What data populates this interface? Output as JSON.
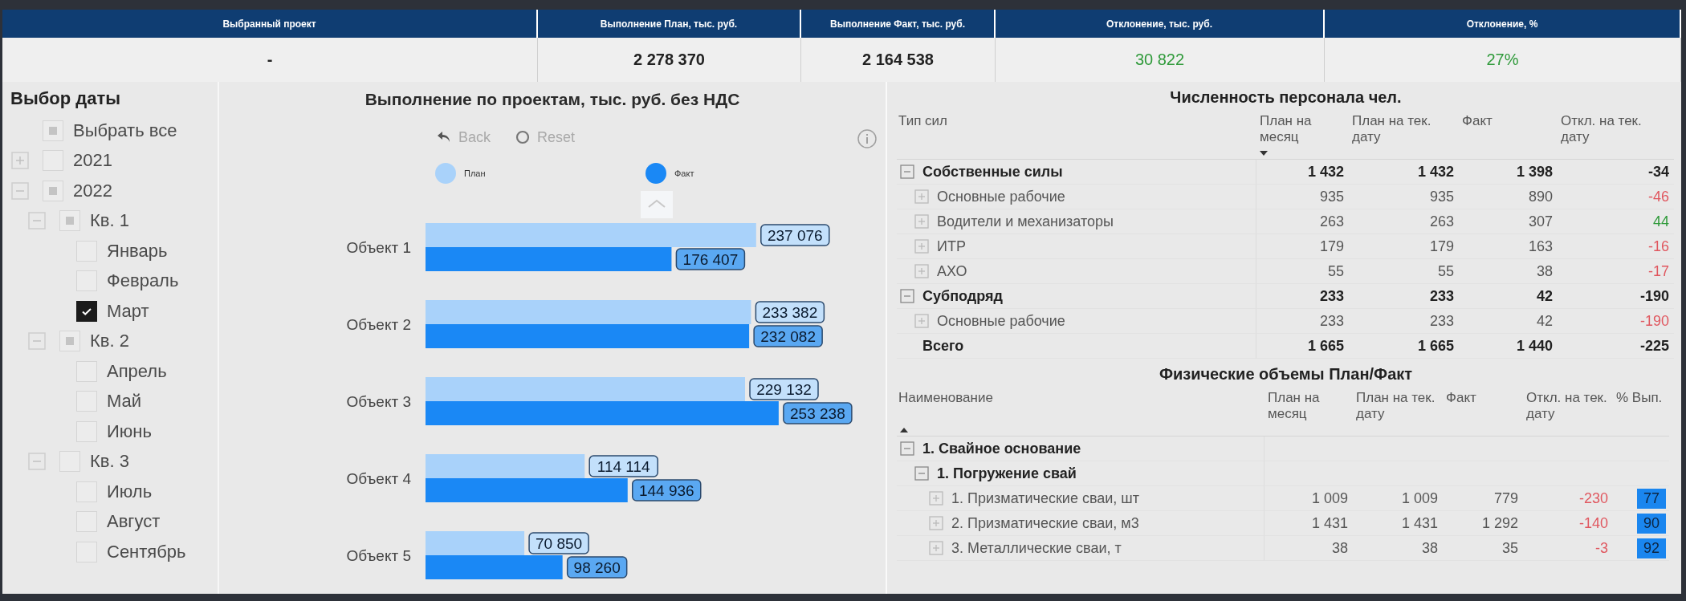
{
  "kpi_header": {
    "columns": [
      {
        "label": "Выбранный проект",
        "value": "-",
        "color": "#222222"
      },
      {
        "label": "Выполнение План, тыс. руб.",
        "value": "2 278 370",
        "color": "#222222"
      },
      {
        "label": "Выполнение Факт, тыс. руб.",
        "value": "2 164 538",
        "color": "#222222"
      },
      {
        "label": "Отклонение, тыс. руб.",
        "value": "30 822",
        "color": "#2f9a3a"
      },
      {
        "label": "Отклонение, %",
        "value": "27%",
        "color": "#2f9a3a"
      }
    ]
  },
  "date_slicer": {
    "title": "Выбор даты",
    "items": [
      {
        "label": "Выбрать все",
        "checked": false,
        "partial": true
      },
      {
        "label": "2021",
        "expanded": false,
        "checked": false,
        "partial": false
      },
      {
        "label": "2022",
        "expanded": true,
        "checked": false,
        "partial": true,
        "children": [
          {
            "label": "Кв. 1",
            "expanded": true,
            "checked": false,
            "partial": true,
            "children": [
              {
                "label": "Январь",
                "checked": false,
                "partial": false
              },
              {
                "label": "Февраль",
                "checked": false,
                "partial": false
              },
              {
                "label": "Март",
                "checked": true
              }
            ]
          },
          {
            "label": "Кв. 2",
            "expanded": true,
            "checked": false,
            "partial": true,
            "children": [
              {
                "label": "Апрель",
                "checked": false,
                "partial": false
              },
              {
                "label": "Май",
                "checked": false,
                "partial": false
              },
              {
                "label": "Июнь",
                "checked": false,
                "partial": false
              }
            ]
          },
          {
            "label": "Кв. 3",
            "expanded": true,
            "checked": false,
            "partial": false,
            "children": [
              {
                "label": "Июль",
                "checked": false,
                "partial": false
              },
              {
                "label": "Август",
                "checked": false,
                "partial": false
              },
              {
                "label": "Сентябрь",
                "checked": false,
                "partial": false
              }
            ]
          }
        ]
      }
    ]
  },
  "project_chart": {
    "title": "Выполнение по проектам, тыс. руб. без НДС",
    "buttons": [
      {
        "label": "Back",
        "kind": "back",
        "disabled": true
      },
      {
        "label": "Reset",
        "kind": "reset",
        "disabled": true
      }
    ],
    "chart_data": {
      "type": "bar",
      "orientation": "horizontal",
      "categories": [
        "Объект 1",
        "Объект 2",
        "Объект 3",
        "Объект 4",
        "Объект 5"
      ],
      "series": [
        {
          "name": "План",
          "color": "#a9d2fa",
          "values": [
            237076,
            233382,
            229132,
            114114,
            70850
          ]
        },
        {
          "name": "Факт",
          "color": "#1a88f5",
          "values": [
            176407,
            232082,
            253238,
            144936,
            98260
          ]
        }
      ],
      "data_labels": true
    }
  },
  "headcount_table": {
    "title": "Численность персонала чел.",
    "columns": [
      {
        "label": "Тип сил",
        "kind": "text",
        "sorted": false
      },
      {
        "label": "План на месяц",
        "kind": "number",
        "sorted": true,
        "ascending": false
      },
      {
        "label": "План на тек. дату",
        "kind": "number",
        "sorted": false
      },
      {
        "label": "Факт",
        "kind": "number",
        "sorted": false
      },
      {
        "label": "Откл. на тек. дату",
        "kind": "deviation",
        "sorted": false
      }
    ],
    "rows": [
      {
        "label": "Собственные силы",
        "kind": "group",
        "expanded": true,
        "values": [
          "1 432",
          "1 432",
          "1 398",
          "-34"
        ],
        "color": "#222222",
        "children": [
          {
            "label": "Основные рабочие",
            "kind": "leaf",
            "expanded": false,
            "values": [
              "935",
              "935",
              "890",
              "-46"
            ],
            "color": "#e0575f"
          },
          {
            "label": "Водители и механизаторы",
            "kind": "leaf",
            "expanded": false,
            "values": [
              "263",
              "263",
              "307",
              "44"
            ],
            "color": "#2f9a3a"
          },
          {
            "label": "ИТР",
            "kind": "leaf",
            "expanded": false,
            "values": [
              "179",
              "179",
              "163",
              "-16"
            ],
            "color": "#e0575f"
          },
          {
            "label": "АХО",
            "kind": "leaf",
            "expanded": false,
            "values": [
              "55",
              "55",
              "38",
              "-17"
            ],
            "color": "#e0575f"
          }
        ]
      },
      {
        "label": "Субподряд",
        "kind": "group",
        "expanded": true,
        "values": [
          "233",
          "233",
          "42",
          "-190"
        ],
        "color": "#222222",
        "children": [
          {
            "label": "Основные рабочие",
            "kind": "leaf",
            "expanded": false,
            "values": [
              "233",
              "233",
              "42",
              "-190"
            ],
            "color": "#e0575f"
          }
        ]
      },
      {
        "label": "Всего",
        "kind": "total",
        "values": [
          "1 665",
          "1 665",
          "1 440",
          "-225"
        ],
        "color": "#222222"
      }
    ]
  },
  "volumes_table": {
    "title": "Физические объемы План/Факт",
    "columns": [
      {
        "label": "Наименование",
        "kind": "text",
        "sorted": true,
        "ascending": true
      },
      {
        "label": "План на месяц",
        "kind": "number",
        "sorted": false
      },
      {
        "label": "План на тек. дату",
        "kind": "number",
        "sorted": false
      },
      {
        "label": "Факт",
        "kind": "number",
        "sorted": false
      },
      {
        "label": "Откл. на тек. дату",
        "kind": "deviation",
        "sorted": false
      },
      {
        "label": "% Вып.",
        "kind": "percent",
        "sorted": false
      }
    ],
    "rows": [
      {
        "label": "1. Свайное основание",
        "kind": "group",
        "expanded": true,
        "children": [
          {
            "label": "1. Погружение свай",
            "kind": "group",
            "expanded": true,
            "children": [
              {
                "label": "1. Призматические сваи, шт",
                "kind": "leaf",
                "expanded": false,
                "values": [
                  "1 009",
                  "1 009",
                  "779",
                  "-230",
                  "77"
                ],
                "color": "#e0575f",
                "highlighted": true
              },
              {
                "label": "2. Призматические сваи, м3",
                "kind": "leaf",
                "expanded": false,
                "values": [
                  "1 431",
                  "1 431",
                  "1 292",
                  "-140",
                  "90"
                ],
                "color": "#e0575f",
                "highlighted": true
              },
              {
                "label": "3. Металлические сваи, т",
                "kind": "leaf",
                "expanded": false,
                "values": [
                  "38",
                  "38",
                  "35",
                  "-3",
                  "92"
                ],
                "color": "#e0575f",
                "highlighted": true
              }
            ]
          }
        ]
      }
    ]
  }
}
